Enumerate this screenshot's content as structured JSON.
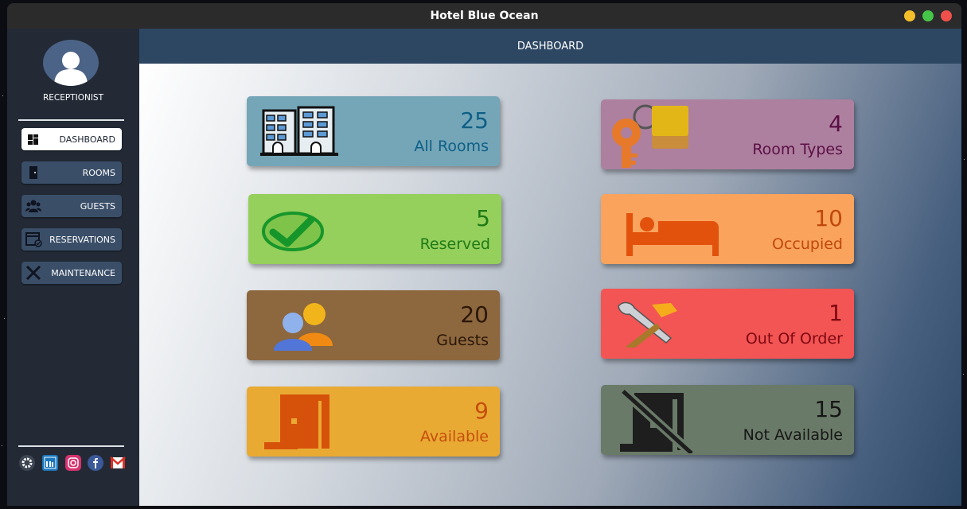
{
  "window": {
    "title": "Hotel Blue Ocean",
    "controls": [
      {
        "name": "minimize",
        "color": "#f5bf2b"
      },
      {
        "name": "maximize",
        "color": "#46c648"
      },
      {
        "name": "close",
        "color": "#f0504b"
      }
    ]
  },
  "sidebar": {
    "role": "RECEPTIONIST",
    "items": [
      {
        "label": "DASHBOARD",
        "icon": "dashboard-icon",
        "active": true
      },
      {
        "label": "ROOMS",
        "icon": "door-icon"
      },
      {
        "label": "GUESTS",
        "icon": "guests-icon"
      },
      {
        "label": "RESERVATIONS",
        "icon": "calendar-icon"
      },
      {
        "label": "MAINTENANCE",
        "icon": "tools-icon"
      }
    ],
    "social": [
      "settings-icon",
      "linkedin-icon",
      "instagram-icon",
      "facebook-icon",
      "gmail-icon"
    ]
  },
  "header": {
    "title": "DASHBOARD"
  },
  "cards": [
    {
      "value": "25",
      "label": "All Rooms",
      "icon": "building-icon",
      "bg": "#75a6b8",
      "color": "#0d5f86"
    },
    {
      "value": "4",
      "label": "Room Types",
      "icon": "key-icon",
      "bg": "#ad809f",
      "color": "#5c0f45"
    },
    {
      "value": "5",
      "label": "Reserved",
      "icon": "checkmark-icon",
      "bg": "#95cf5c",
      "color": "#1f7a16"
    },
    {
      "value": "10",
      "label": "Occupied",
      "icon": "bed-icon",
      "bg": "#f9a35d",
      "color": "#c0480d"
    },
    {
      "value": "20",
      "label": "Guests",
      "icon": "people-icon",
      "bg": "#8d673e",
      "color": "#2a1706"
    },
    {
      "value": "1",
      "label": "Out Of Order",
      "icon": "tools-icon",
      "bg": "#f35454",
      "color": "#7d0912"
    },
    {
      "value": "9",
      "label": "Available",
      "icon": "open-door-icon",
      "bg": "#e9aa34",
      "color": "#c54d0a"
    },
    {
      "value": "15",
      "label": "Not Available",
      "icon": "no-door-icon",
      "bg": "#6a7a68",
      "color": "#161616"
    }
  ]
}
